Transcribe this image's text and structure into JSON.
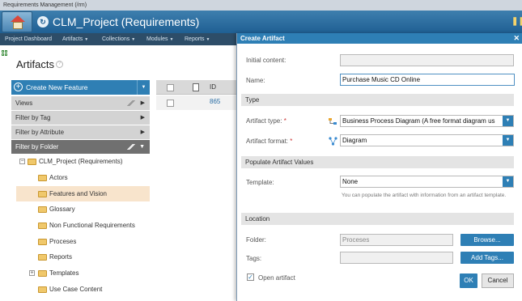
{
  "app": {
    "banner": "Requirements Management (/rm)",
    "project_title": "CLM_Project (Requirements)"
  },
  "nav": {
    "items": [
      "Project Dashboard",
      "Artifacts",
      "Collections",
      "Modules",
      "Reports"
    ]
  },
  "left": {
    "title": "Artifacts",
    "create_button": "Create New Feature",
    "accordions": [
      "Views",
      "Filter by Tag",
      "Filter by Attribute",
      "Filter by Folder"
    ],
    "tree_root": "CLM_Project (Requirements)",
    "tree_items": [
      "Actors",
      "Features and Vision",
      "Glossary",
      "Non Functional Requirements",
      "Proceses",
      "Reports",
      "Templates",
      "Use Case Content"
    ]
  },
  "grid": {
    "id_header": "ID",
    "rows": [
      "865"
    ]
  },
  "dialog": {
    "title": "Create Artifact",
    "initial_content_label": "Initial content:",
    "name_label": "Name:",
    "name_value": "Purchase Music CD Online",
    "type_section": "Type",
    "artifact_type_label": "Artifact type:",
    "artifact_type_value": "Business Process Diagram (A free format diagram us",
    "artifact_format_label": "Artifact format:",
    "artifact_format_value": "Diagram",
    "populate_section": "Populate Artifact Values",
    "template_label": "Template:",
    "template_value": "None",
    "template_hint": "You can populate the artifact with information from an artifact template.",
    "location_section": "Location",
    "folder_label": "Folder:",
    "folder_value": "Proceses",
    "browse_button": "Browse...",
    "tags_label": "Tags:",
    "add_tags_button": "Add Tags...",
    "open_artifact_label": "Open artifact",
    "ok_button": "OK",
    "cancel_button": "Cancel"
  }
}
